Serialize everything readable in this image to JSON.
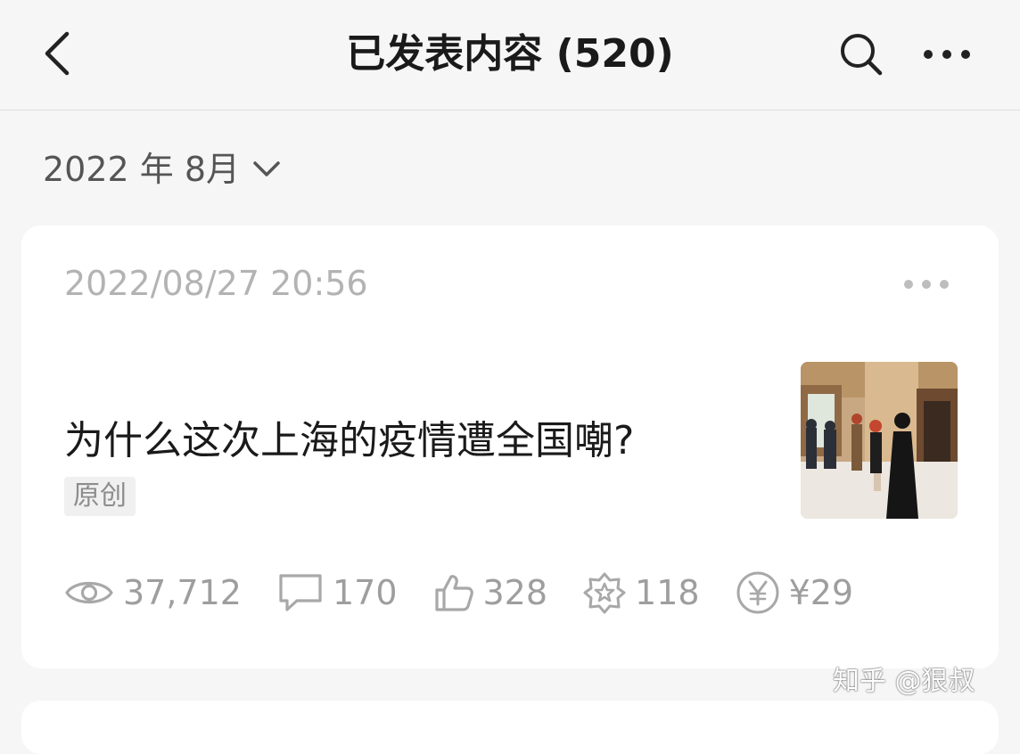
{
  "header": {
    "title": "已发表内容 (520)",
    "back_icon": "chevron-left-icon",
    "search_icon": "search-icon",
    "more_icon": "more-horizontal-icon"
  },
  "filter": {
    "label": "2022 年 8月",
    "icon": "chevron-down-icon"
  },
  "post": {
    "timestamp": "2022/08/27 20:56",
    "title": "为什么这次上海的疫情遭全国嘲?",
    "tag": "原创",
    "stats": {
      "views": "37,712",
      "comments": "170",
      "likes": "328",
      "favorites": "118",
      "earnings": "¥29"
    }
  },
  "watermark": "知乎 @狠叔",
  "colors": {
    "background": "#f6f6f6",
    "card": "#ffffff",
    "title_text": "#1a1a1a",
    "muted_text": "#9e9e9e",
    "timestamp_text": "#b3b3b3"
  }
}
